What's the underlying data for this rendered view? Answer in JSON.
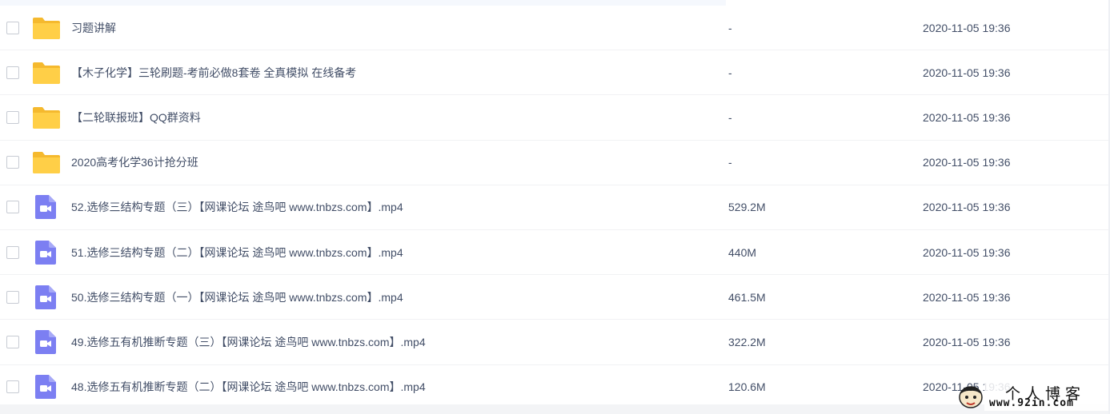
{
  "files": [
    {
      "type": "folder",
      "name": "习题讲解",
      "size": "-",
      "date": "2020-11-05 19:36"
    },
    {
      "type": "folder",
      "name": "【木子化学】三轮刷题-考前必做8套卷 全真模拟 在线备考",
      "size": "-",
      "date": "2020-11-05 19:36"
    },
    {
      "type": "folder",
      "name": "【二轮联报班】QQ群资料",
      "size": "-",
      "date": "2020-11-05 19:36"
    },
    {
      "type": "folder",
      "name": "2020高考化学36计抢分班",
      "size": "-",
      "date": "2020-11-05 19:36"
    },
    {
      "type": "video",
      "name": "52.选修三结构专题（三）【网课论坛 途鸟吧 www.tnbzs.com】.mp4",
      "size": "529.2M",
      "date": "2020-11-05 19:36"
    },
    {
      "type": "video",
      "name": "51.选修三结构专题（二）【网课论坛 途鸟吧 www.tnbzs.com】.mp4",
      "size": "440M",
      "date": "2020-11-05 19:36"
    },
    {
      "type": "video",
      "name": "50.选修三结构专题（一）【网课论坛 途鸟吧 www.tnbzs.com】.mp4",
      "size": "461.5M",
      "date": "2020-11-05 19:36"
    },
    {
      "type": "video",
      "name": "49.选修五有机推断专题（三）【网课论坛 途鸟吧 www.tnbzs.com】.mp4",
      "size": "322.2M",
      "date": "2020-11-05 19:36"
    },
    {
      "type": "video",
      "name": "48.选修五有机推断专题（二）【网课论坛 途鸟吧 www.tnbzs.com】.mp4",
      "size": "120.6M",
      "date": "2020-11-05 19:36"
    }
  ],
  "watermark": {
    "title": "个人博客",
    "url": "www.92in.com"
  },
  "colors": {
    "folder": "#ffcf47",
    "folder_tab": "#f5b92e",
    "video": "#7c7ff2",
    "text": "#424e67"
  },
  "icons": {
    "folder": "folder-icon",
    "video": "video-file-icon"
  }
}
